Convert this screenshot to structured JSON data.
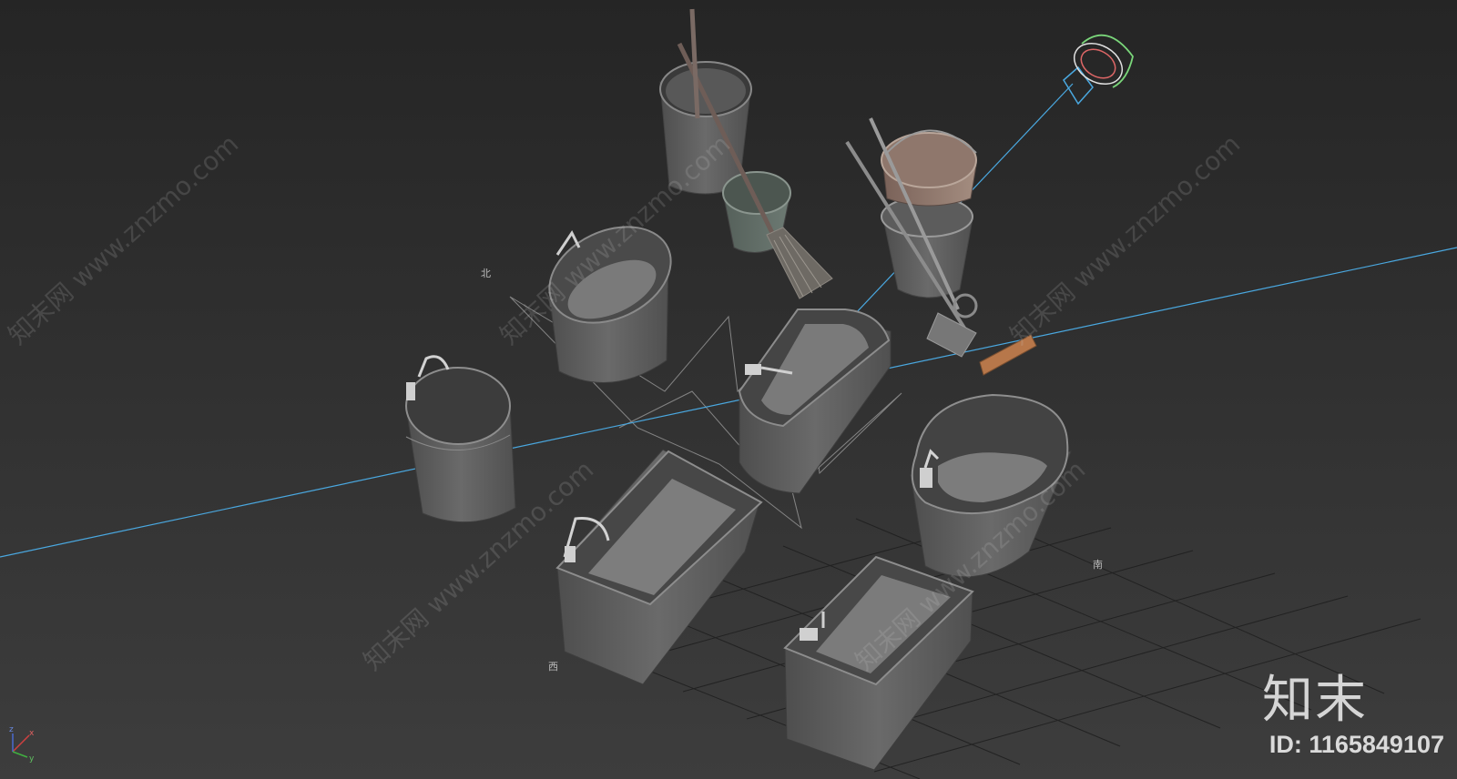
{
  "viewport": {
    "background_top": "#262626",
    "background_bottom": "#3e3e3e",
    "grid_color": "#1c1c1c",
    "axis_line_color": "#4aa8e0"
  },
  "compass": {
    "north": "北",
    "south": "南",
    "west": "西"
  },
  "axis_tripod": {
    "x": "x",
    "y": "y",
    "z": "z"
  },
  "watermark": {
    "text": "知末网 www.znzmo.com",
    "brand": "知末",
    "id_label": "ID: 1165849107"
  },
  "objects": [
    {
      "name": "bucket-with-mop"
    },
    {
      "name": "small-green-bucket"
    },
    {
      "name": "broom"
    },
    {
      "name": "bucket-stack-tan"
    },
    {
      "name": "squeeze-mop"
    },
    {
      "name": "oval-tub"
    },
    {
      "name": "round-tub"
    },
    {
      "name": "rectangular-tub-center"
    },
    {
      "name": "kidney-tub"
    },
    {
      "name": "rectangular-tub-front-left"
    },
    {
      "name": "rectangular-tub-front-right"
    },
    {
      "name": "light-gizmo"
    }
  ]
}
